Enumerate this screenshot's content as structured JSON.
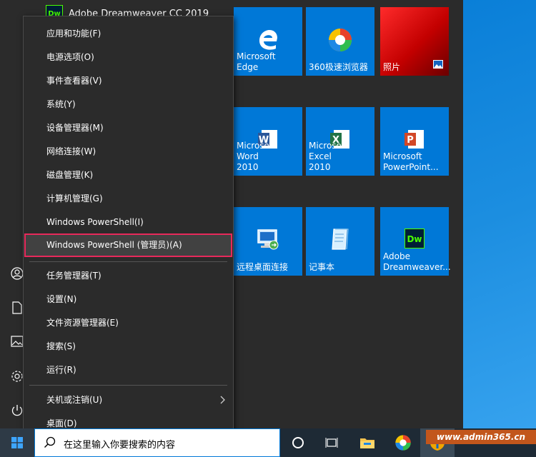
{
  "start_menu": {
    "top_app": "Adobe Dreamweaver CC 2019"
  },
  "tiles": [
    {
      "label": "Microsoft Edge",
      "icon": "edge-icon"
    },
    {
      "label": "360极速浏览器",
      "icon": "browser-360-icon"
    },
    {
      "label": "照片",
      "icon": "photos-icon"
    },
    {
      "label": "Microsoft Word\n2010",
      "icon": "word-icon"
    },
    {
      "label": "Microsoft Excel\n2010",
      "icon": "excel-icon"
    },
    {
      "label": "Microsoft\nPowerPoint...",
      "icon": "powerpoint-icon"
    },
    {
      "label": "远程桌面连接",
      "icon": "remote-desktop-icon"
    },
    {
      "label": "记事本",
      "icon": "notepad-icon"
    },
    {
      "label": "Adobe\nDreamweaver...",
      "icon": "dreamweaver-icon"
    }
  ],
  "context_menu": {
    "group1": [
      "应用和功能(F)",
      "电源选项(O)",
      "事件查看器(V)",
      "系统(Y)",
      "设备管理器(M)",
      "网络连接(W)",
      "磁盘管理(K)",
      "计算机管理(G)",
      "Windows PowerShell(I)",
      "Windows PowerShell (管理员)(A)"
    ],
    "group2": [
      "任务管理器(T)",
      "设置(N)",
      "文件资源管理器(E)",
      "搜索(S)",
      "运行(R)"
    ],
    "group3": [
      "关机或注销(U)",
      "桌面(D)"
    ]
  },
  "taskbar": {
    "search_placeholder": "在这里输入你要搜索的内容",
    "watermark": "www.admin365.cn"
  },
  "colors": {
    "tile_blue": "#0078d7",
    "highlight_border": "#e8295b",
    "menu_bg": "#2b2b2b"
  }
}
